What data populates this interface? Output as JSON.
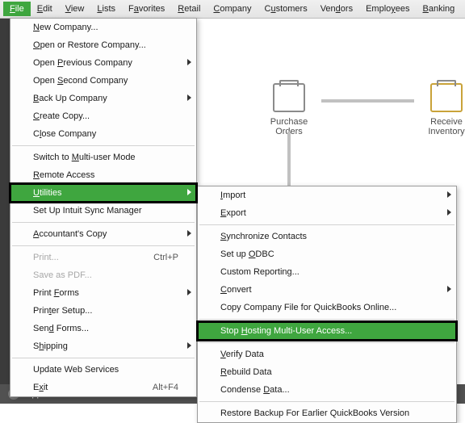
{
  "menubar": {
    "items": [
      {
        "label": "File",
        "u": "F",
        "active": true
      },
      {
        "label": "Edit",
        "u": "E"
      },
      {
        "label": "View",
        "u": "V"
      },
      {
        "label": "Lists",
        "u": "L"
      },
      {
        "label": "Favorites",
        "u": "a"
      },
      {
        "label": "Retail",
        "u": "R"
      },
      {
        "label": "Company",
        "u": "C"
      },
      {
        "label": "Customers",
        "u": "u"
      },
      {
        "label": "Vendors",
        "u": "d"
      },
      {
        "label": "Employees",
        "u": "y"
      },
      {
        "label": "Banking",
        "u": "B"
      }
    ]
  },
  "bottom": {
    "label": "App Center"
  },
  "workspace": {
    "purchase": "Purchase",
    "orders": "Orders",
    "receive": "Receive",
    "inventory": "Inventory"
  },
  "fileMenu": [
    {
      "t": "item",
      "label": "New Company...",
      "u": "N"
    },
    {
      "t": "item",
      "label": "Open or Restore Company...",
      "u": "O"
    },
    {
      "t": "item",
      "label": "Open Previous Company",
      "u": "P",
      "sub": true
    },
    {
      "t": "item",
      "label": "Open Second Company",
      "u": "S"
    },
    {
      "t": "item",
      "label": "Back Up Company",
      "u": "B",
      "sub": true
    },
    {
      "t": "item",
      "label": "Create Copy...",
      "u": "C"
    },
    {
      "t": "item",
      "label": "Close Company",
      "u": "l"
    },
    {
      "t": "sep"
    },
    {
      "t": "item",
      "label": "Switch to Multi-user Mode",
      "u": "M"
    },
    {
      "t": "item",
      "label": "Remote Access",
      "u": "R"
    },
    {
      "t": "item",
      "label": "Utilities",
      "u": "U",
      "sub": true,
      "hl": true,
      "emph": true
    },
    {
      "t": "item",
      "label": "Set Up Intuit Sync Manager"
    },
    {
      "t": "sep"
    },
    {
      "t": "item",
      "label": "Accountant's Copy",
      "u": "A",
      "sub": true
    },
    {
      "t": "sep"
    },
    {
      "t": "item",
      "label": "Print...",
      "shortcut": "Ctrl+P",
      "disabled": true
    },
    {
      "t": "item",
      "label": "Save as PDF...",
      "disabled": true
    },
    {
      "t": "item",
      "label": "Print Forms",
      "u": "F",
      "sub": true
    },
    {
      "t": "item",
      "label": "Printer Setup...",
      "u": "t"
    },
    {
      "t": "item",
      "label": "Send Forms...",
      "u": "d"
    },
    {
      "t": "item",
      "label": "Shipping",
      "u": "h",
      "sub": true
    },
    {
      "t": "sep"
    },
    {
      "t": "item",
      "label": "Update Web Services"
    },
    {
      "t": "item",
      "label": "Exit",
      "u": "x",
      "shortcut": "Alt+F4"
    }
  ],
  "utilMenu": [
    {
      "t": "item",
      "label": "Import",
      "u": "I",
      "sub": true
    },
    {
      "t": "item",
      "label": "Export",
      "u": "E",
      "sub": true
    },
    {
      "t": "sep"
    },
    {
      "t": "item",
      "label": "Synchronize Contacts",
      "u": "S"
    },
    {
      "t": "item",
      "label": "Set up ODBC",
      "u": "O"
    },
    {
      "t": "item",
      "label": "Custom Reporting..."
    },
    {
      "t": "item",
      "label": "Convert",
      "u": "C",
      "sub": true
    },
    {
      "t": "item",
      "label": "Copy Company File for QuickBooks Online..."
    },
    {
      "t": "sep"
    },
    {
      "t": "item",
      "label": "Stop Hosting Multi-User Access...",
      "u": "H",
      "hl": true,
      "emph": true
    },
    {
      "t": "sep"
    },
    {
      "t": "item",
      "label": "Verify Data",
      "u": "V"
    },
    {
      "t": "item",
      "label": "Rebuild Data",
      "u": "R"
    },
    {
      "t": "item",
      "label": "Condense Data...",
      "u": "D"
    },
    {
      "t": "sep"
    },
    {
      "t": "item",
      "label": "Restore Backup For Earlier QuickBooks Version"
    }
  ]
}
